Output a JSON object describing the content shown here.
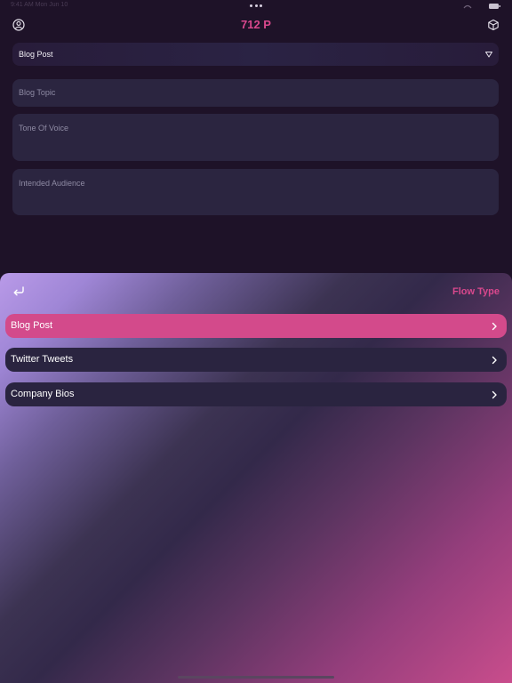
{
  "status_bar": {
    "left_text": "9:41 AM  Mon Jun 10"
  },
  "header": {
    "title": "712 P",
    "profile_icon": "person-circle-icon",
    "cube_icon": "cube-icon"
  },
  "form": {
    "flow_select": {
      "value": "Blog Post",
      "icon": "triangle-down-icon"
    },
    "fields": [
      {
        "placeholder": "Blog Topic"
      },
      {
        "placeholder": "Tone Of Voice"
      },
      {
        "placeholder": "Intended Audience"
      }
    ]
  },
  "sheet": {
    "title": "Flow Type",
    "back_icon": "return-arrow-icon",
    "options": [
      {
        "label": "Blog Post",
        "selected": true
      },
      {
        "label": "Twitter Tweets",
        "selected": false
      },
      {
        "label": "Company Bios",
        "selected": false
      }
    ]
  },
  "colors": {
    "accent": "#d9488d",
    "background": "#1e1228",
    "field": "#2b2540",
    "option": "#2a2440"
  }
}
